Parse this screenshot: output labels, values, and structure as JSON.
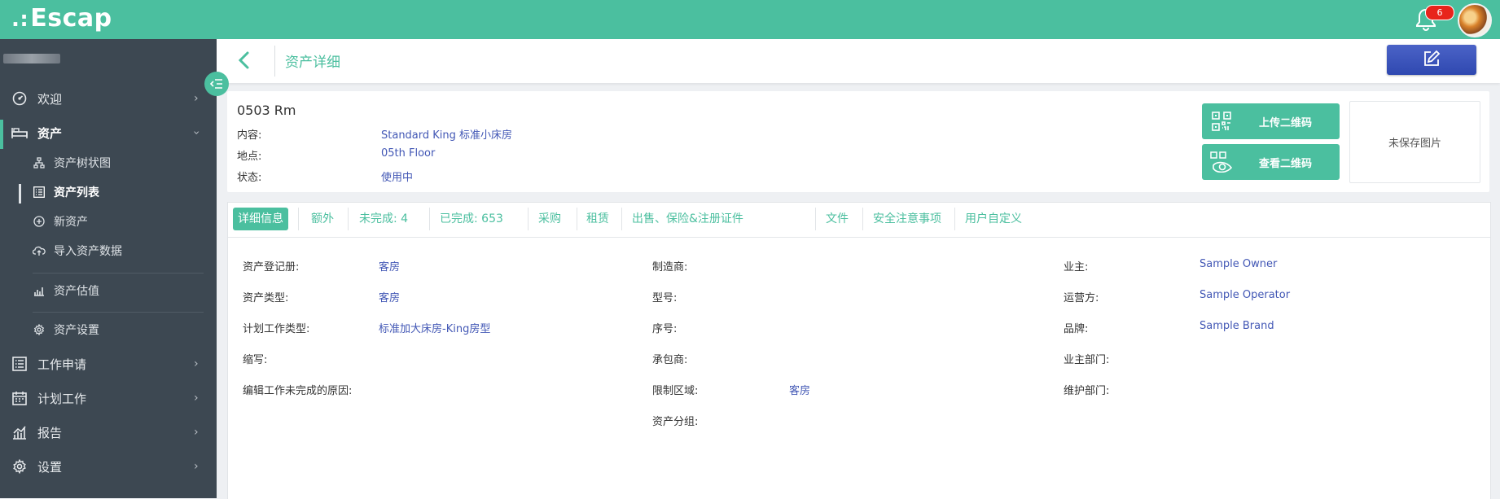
{
  "app": {
    "logo": "Escap",
    "notification_count": "6"
  },
  "sidebar": {
    "items": [
      {
        "label": "欢迎",
        "icon": "dashboard-icon"
      },
      {
        "label": "资产",
        "icon": "bed-icon"
      },
      {
        "label": "工作申请",
        "icon": "list-icon"
      },
      {
        "label": "计划工作",
        "icon": "calendar-icon"
      },
      {
        "label": "报告",
        "icon": "chart-icon"
      },
      {
        "label": "设置",
        "icon": "gear-icon"
      }
    ],
    "sub_items": [
      {
        "label": "资产树状图",
        "icon": "tree-icon"
      },
      {
        "label": "资产列表",
        "icon": "list-icon"
      },
      {
        "label": "新资产",
        "icon": "plus-circle-icon"
      },
      {
        "label": "导入资产数据",
        "icon": "cloud-upload-icon"
      },
      {
        "label": "资产估值",
        "icon": "bar-chart-icon"
      },
      {
        "label": "资产设置",
        "icon": "gear-icon"
      }
    ]
  },
  "header": {
    "title": "资产详细"
  },
  "asset": {
    "room": "0503 Rm",
    "content_label": "内容:",
    "content_value": "Standard King 标准小床房",
    "location_label": "地点:",
    "location_value": "05th Floor",
    "status_label": "状态:",
    "status_value": "使用中"
  },
  "actions": {
    "upload_qr": "上传二维码",
    "view_qr": "查看二维码",
    "no_image": "未保存图片"
  },
  "tabs": [
    "详细信息",
    "额外",
    "未完成: 4",
    "已完成: 653",
    "采购",
    "租赁",
    "出售、保险&注册证件",
    "文件",
    "安全注意事项",
    "用户自定义"
  ],
  "details": {
    "col1": [
      {
        "label": "资产登记册:",
        "value": "客房"
      },
      {
        "label": "资产类型:",
        "value": "客房"
      },
      {
        "label": "计划工作类型:",
        "value": "标准加大床房-King房型"
      },
      {
        "label": "缩写:",
        "value": ""
      },
      {
        "label": "编辑工作未完成的原因:",
        "value": ""
      }
    ],
    "col2": [
      {
        "label": "制造商:",
        "value": ""
      },
      {
        "label": "型号:",
        "value": ""
      },
      {
        "label": "序号:",
        "value": ""
      },
      {
        "label": "承包商:",
        "value": ""
      },
      {
        "label": "限制区域:",
        "value": "客房"
      },
      {
        "label": "资产分组:",
        "value": ""
      }
    ],
    "col3": [
      {
        "label": "业主:",
        "value": "Sample Owner"
      },
      {
        "label": "运营方:",
        "value": "Sample Operator"
      },
      {
        "label": "品牌:",
        "value": "Sample Brand"
      },
      {
        "label": "业主部门:",
        "value": ""
      },
      {
        "label": "维护部门:",
        "value": ""
      }
    ]
  },
  "colors": {
    "accent": "#4bbf9f",
    "sidebar": "#3d4852",
    "link": "#4257b5",
    "edit_button": "#3550b8",
    "badge": "#e8241c"
  }
}
